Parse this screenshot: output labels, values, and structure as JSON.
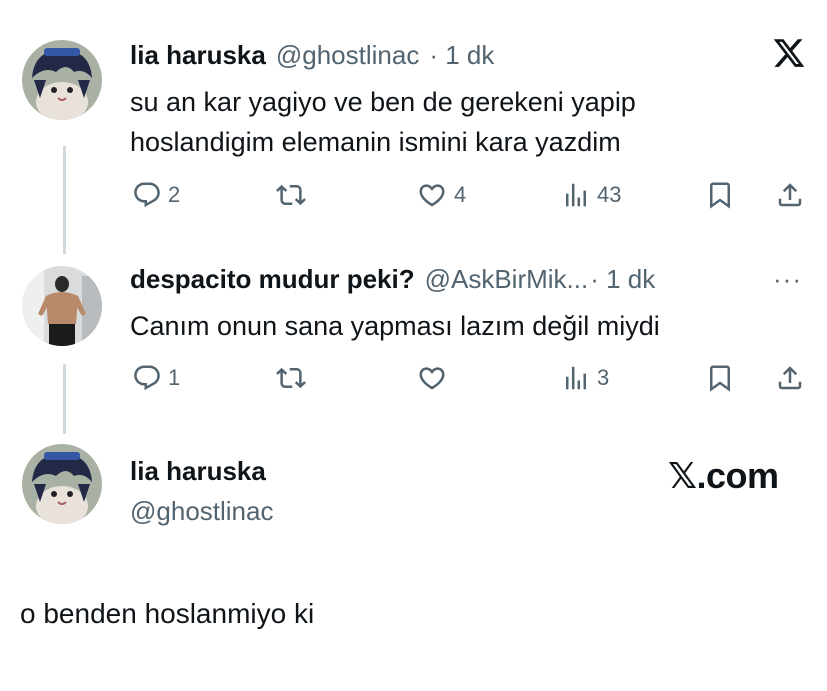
{
  "colors": {
    "text": "#0f1419",
    "muted": "#536471",
    "line": "#cfd9de"
  },
  "tweet1": {
    "name": "lia haruska",
    "handle": "@ghostlinac",
    "time": "· 1 dk",
    "text_line1": "su an kar yagiyo ve ben de gerekeni yapip",
    "text_line2": "hoslandigim elemanin ismini kara yazdim",
    "replies": "2",
    "retweets": "",
    "likes": "4",
    "views": "43"
  },
  "tweet2": {
    "name": "despacito mudur peki?",
    "handle": "@AskBirMik...",
    "time": "· 1 dk",
    "text": "Canım onun sana yapması lazım değil miydi",
    "replies": "1",
    "retweets": "",
    "likes": "",
    "views": "3",
    "more": "···"
  },
  "reply_card": {
    "name": "lia haruska",
    "handle": "@ghostlinac",
    "brand": "𝕏.com",
    "text": "o benden hoslanmiyo ki"
  },
  "icons": {
    "logo": "x-logo-icon",
    "reply": "reply-icon",
    "retweet": "retweet-icon",
    "like": "heart-icon",
    "views": "views-icon",
    "bookmark": "bookmark-icon",
    "share": "share-icon"
  }
}
